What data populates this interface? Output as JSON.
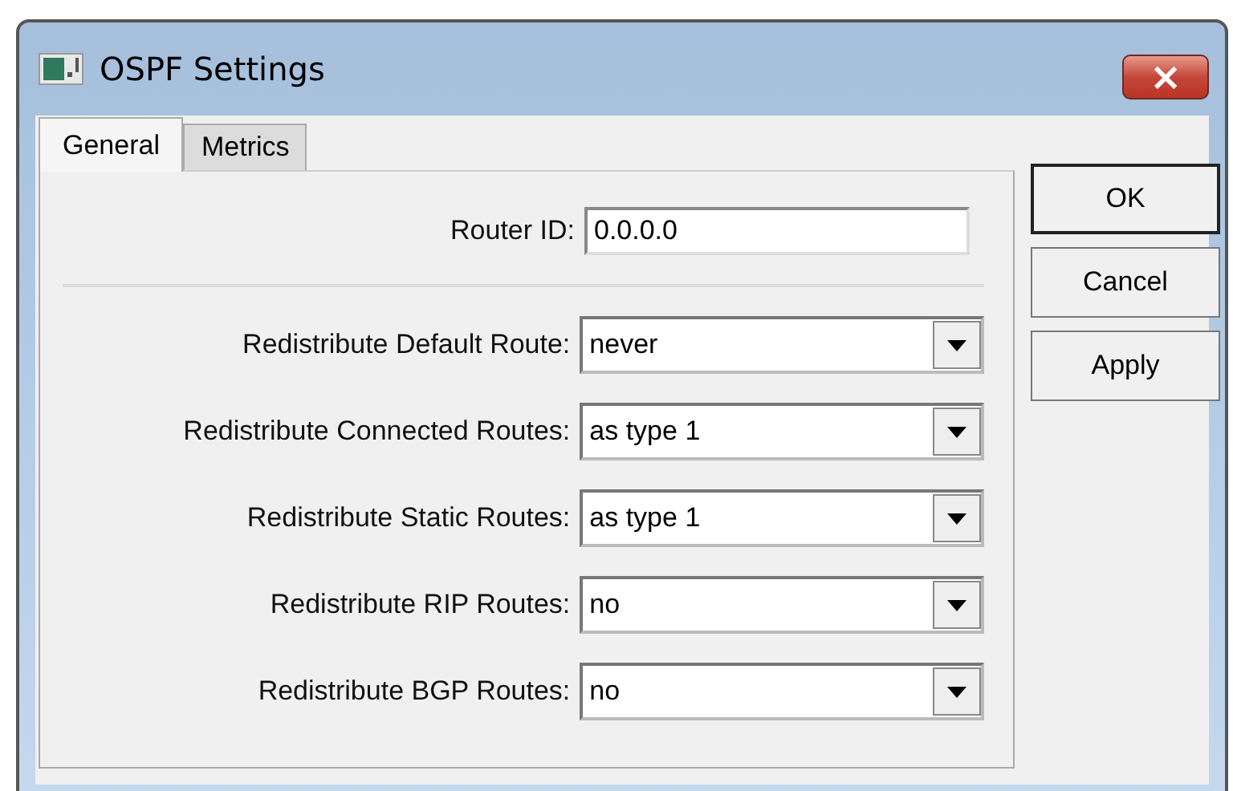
{
  "window": {
    "title": "OSPF Settings",
    "close": "×"
  },
  "tabs": [
    {
      "label": "General",
      "selected": true
    },
    {
      "label": "Metrics",
      "selected": false
    }
  ],
  "fields": [
    {
      "kind": "text",
      "label": "Router ID:",
      "value": "0.0.0.0"
    },
    {
      "kind": "separator"
    },
    {
      "kind": "dropdown",
      "label": "Redistribute Default Route:",
      "value": "never"
    },
    {
      "kind": "dropdown",
      "label": "Redistribute Connected Routes:",
      "value": "as type 1"
    },
    {
      "kind": "dropdown",
      "label": "Redistribute Static Routes:",
      "value": "as type 1"
    },
    {
      "kind": "dropdown",
      "label": "Redistribute RIP Routes:",
      "value": "no"
    },
    {
      "kind": "dropdown",
      "label": "Redistribute BGP Routes:",
      "value": "no"
    }
  ],
  "buttons": [
    {
      "label": "OK",
      "default": true
    },
    {
      "label": "Cancel",
      "default": false
    },
    {
      "label": "Apply",
      "default": false
    }
  ]
}
